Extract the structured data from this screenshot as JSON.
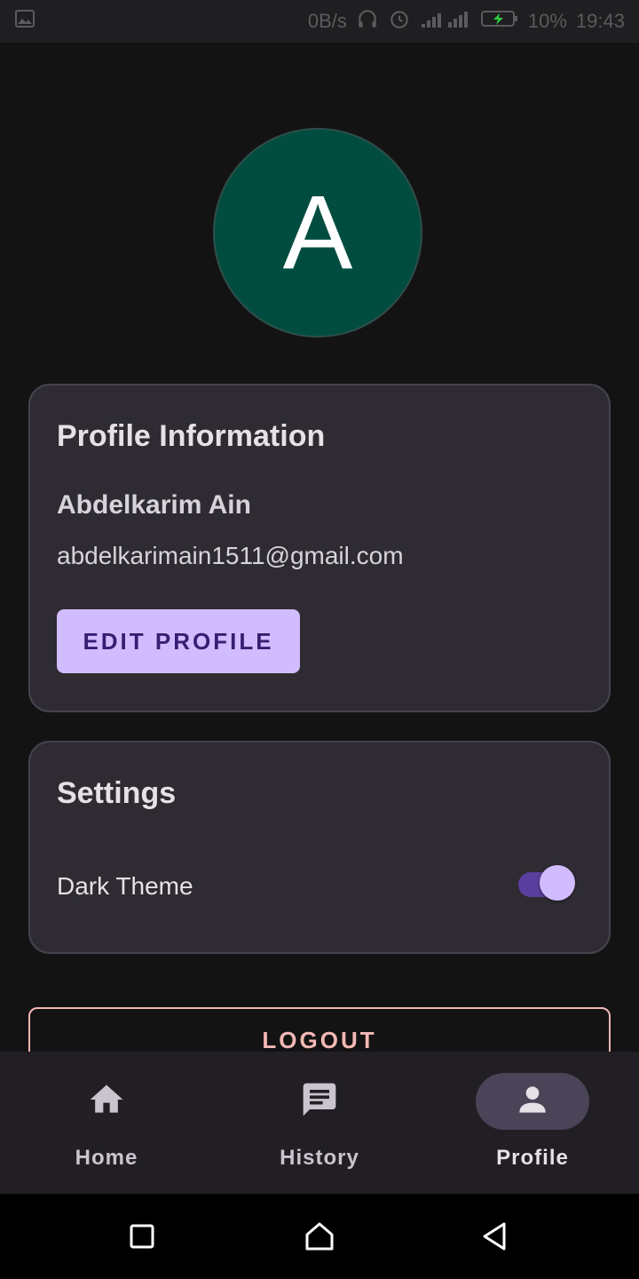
{
  "status_bar": {
    "network_speed": "0B/s",
    "battery": "10%",
    "time": "19:43"
  },
  "avatar": {
    "initial": "A"
  },
  "profile_card": {
    "title": "Profile Information",
    "name": "Abdelkarim Ain",
    "email": "abdelkarimain1511@gmail.com",
    "edit_button": "EDIT PROFILE"
  },
  "settings_card": {
    "title": "Settings",
    "dark_theme_label": "Dark Theme",
    "dark_theme_enabled": true
  },
  "logout_button": "LOGOUT",
  "bottom_nav": {
    "items": [
      {
        "label": "Home",
        "icon": "home-icon",
        "active": false
      },
      {
        "label": "History",
        "icon": "chat-icon",
        "active": false
      },
      {
        "label": "Profile",
        "icon": "person-icon",
        "active": true
      }
    ]
  },
  "colors": {
    "background": "#141314",
    "card": "#2e2b33",
    "avatar": "#004d40",
    "primary": "#d0bcff",
    "logout": "#f2b8b5"
  }
}
